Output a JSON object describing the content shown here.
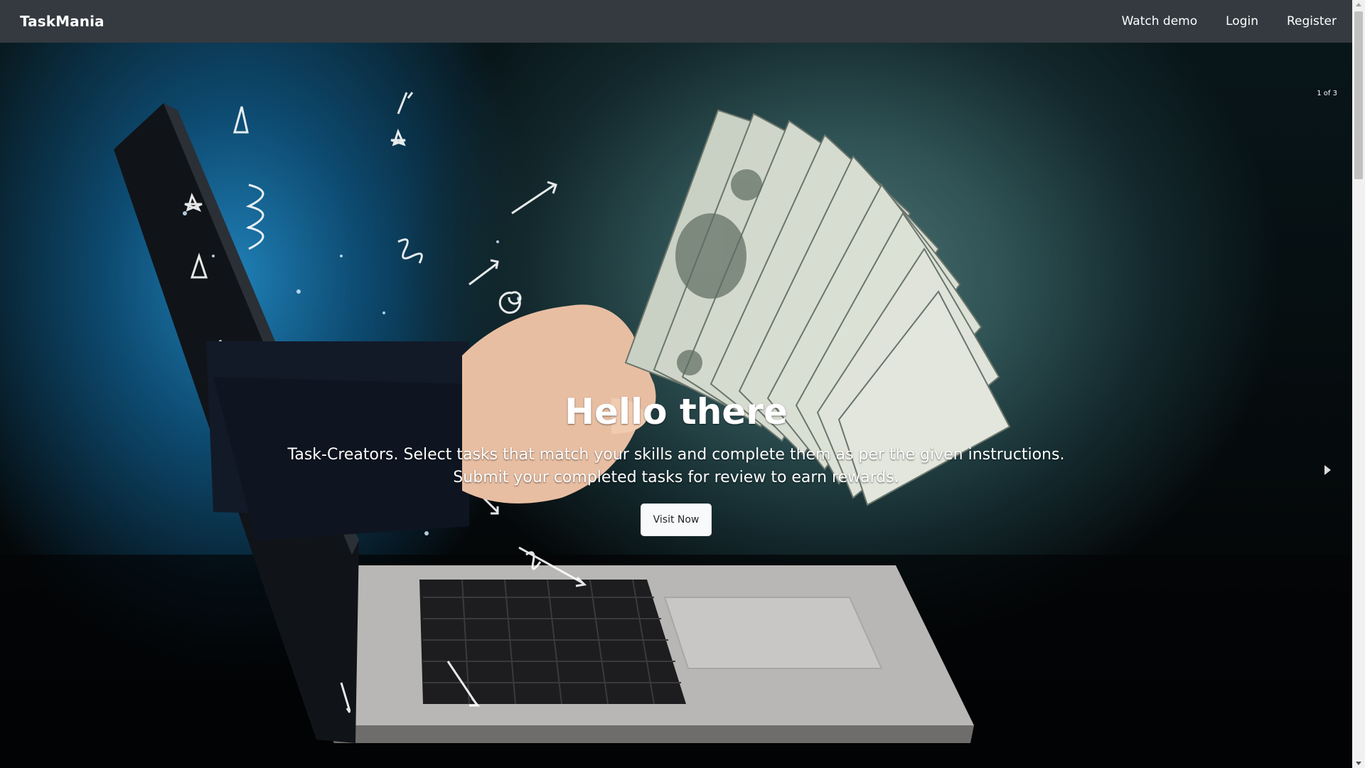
{
  "navbar": {
    "brand": "TaskMania",
    "links": [
      {
        "label": "Watch demo"
      },
      {
        "label": "Login"
      },
      {
        "label": "Register"
      }
    ]
  },
  "carousel": {
    "counter": "1 of 3",
    "slide": {
      "heading": "Hello there",
      "text": "Task-Creators. Select tasks that match your skills and complete them as per the given instructions. Submit your completed tasks for review to earn rewards.",
      "button_label": "Visit Now"
    }
  },
  "icons": {
    "next": "chevron-right-icon",
    "scroll_up": "scroll-up-icon",
    "scroll_down": "scroll-down-icon"
  },
  "colors": {
    "navbar_bg": "#343a40",
    "button_bg": "#f8f9fa",
    "text": "#ffffff"
  }
}
